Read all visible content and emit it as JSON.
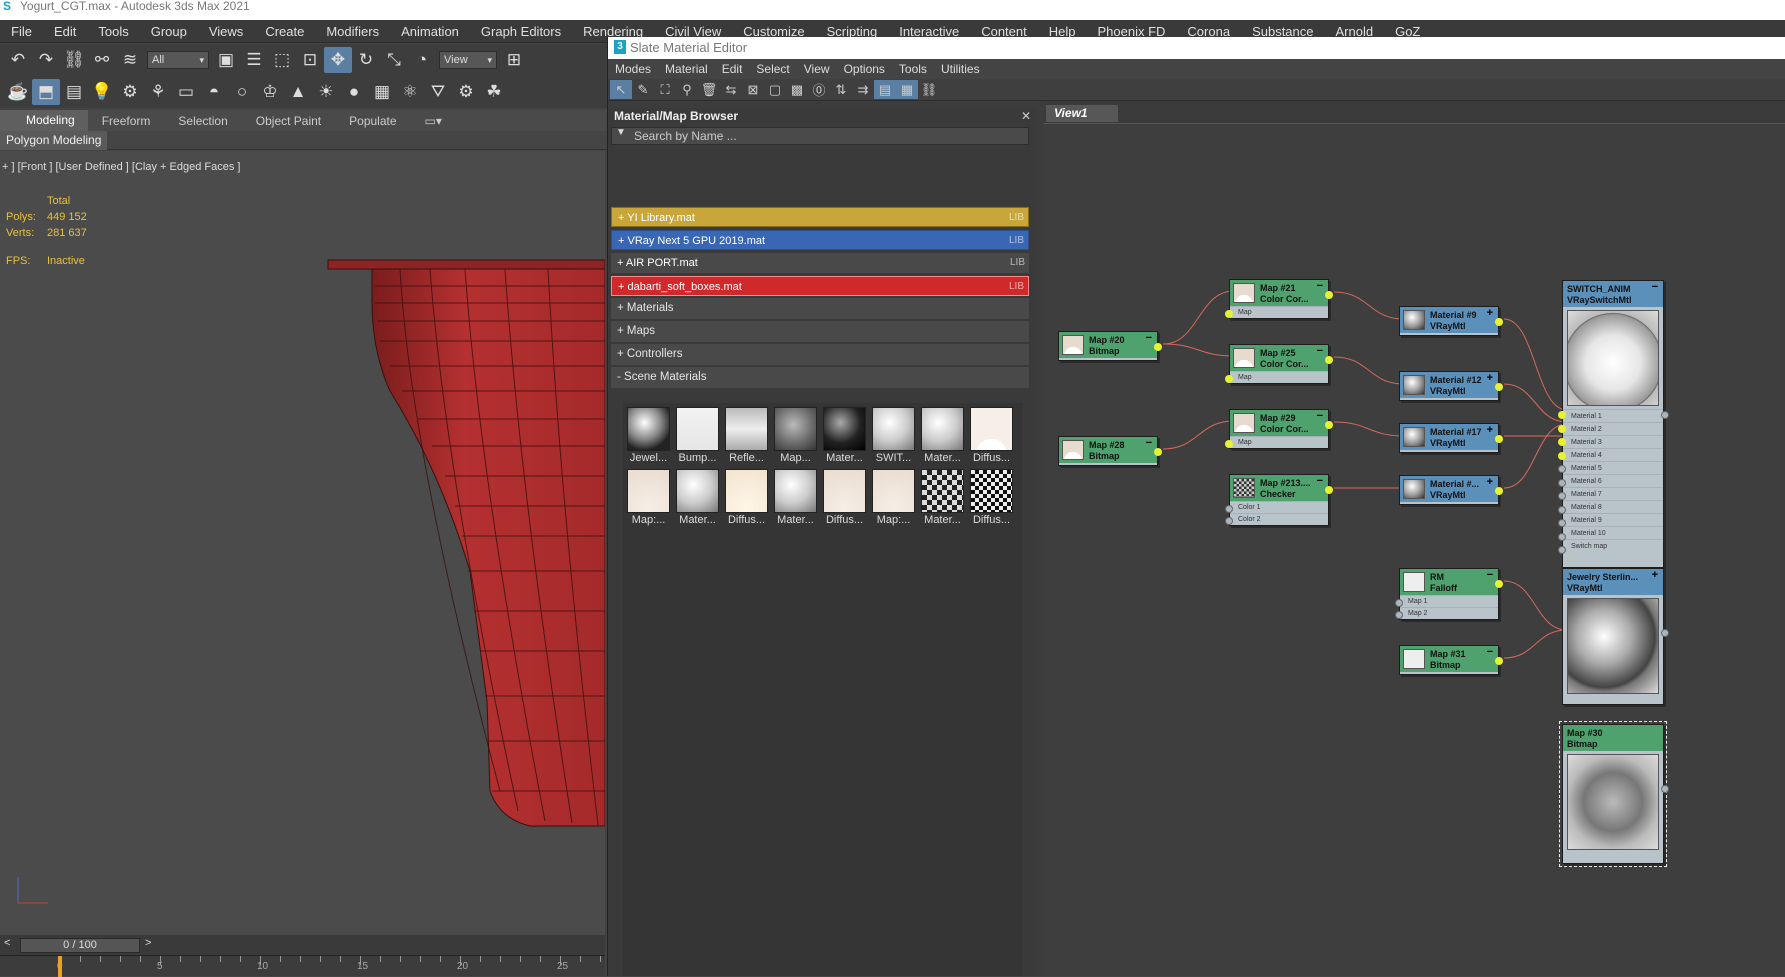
{
  "window": {
    "title": "Yogurt_CGT.max - Autodesk 3ds Max 2021"
  },
  "menubar": [
    "File",
    "Edit",
    "Tools",
    "Group",
    "Views",
    "Create",
    "Modifiers",
    "Animation",
    "Graph Editors",
    "Rendering",
    "Civil View",
    "Customize",
    "Scripting",
    "Interactive",
    "Content",
    "Help",
    "Phoenix FD",
    "Corona",
    "Substance",
    "Arnold",
    "GoZ"
  ],
  "toolbar": {
    "selection_filter": "All",
    "ref_coord": "View"
  },
  "ribbon": {
    "tabs": [
      "Modeling",
      "Freeform",
      "Selection",
      "Object Paint",
      "Populate"
    ],
    "active": "Modeling",
    "sub": "Polygon Modeling"
  },
  "viewport": {
    "label": "+ ] [Front ] [User Defined ] [Clay + Edged Faces ]",
    "total": "Total",
    "polys_label": "Polys:",
    "polys": "449 152",
    "verts_label": "Verts:",
    "verts": "281 637",
    "fps_label": "FPS:",
    "fps": "Inactive"
  },
  "timeline": {
    "frame": "0 / 100",
    "ticks": [
      "0",
      "5",
      "10",
      "15",
      "20",
      "25"
    ]
  },
  "slate": {
    "title": "Slate Material Editor",
    "menu": [
      "Modes",
      "Material",
      "Edit",
      "Select",
      "View",
      "Options",
      "Tools",
      "Utilities"
    ],
    "browser_title": "Material/Map Browser",
    "search_placeholder": "Search by Name ...",
    "libraries": [
      {
        "label": "+ YI Library.mat",
        "tag": "LIB",
        "color": "#c9a63a"
      },
      {
        "label": "+ VRay Next 5 GPU 2019.mat",
        "tag": "LIB",
        "color": "#3a67b3"
      },
      {
        "label": "+ AIR PORT.mat",
        "tag": "LIB",
        "color": "#494949"
      },
      {
        "label": "+ dabarti_soft_boxes.mat",
        "tag": "LIB",
        "color": "#d0282b"
      }
    ],
    "sections": [
      "+ Materials",
      "+ Maps",
      "+ Controllers",
      "- Scene Materials"
    ],
    "swatches": [
      "Jewel...",
      "Bump...",
      "Refle...",
      "Map...",
      "Mater...",
      "SWIT...",
      "Mater...",
      "Diffus...",
      "Map:...",
      "Mater...",
      "Diffus...",
      "Mater...",
      "Diffus...",
      "Map:...",
      "Mater...",
      "Diffus..."
    ],
    "view_tab": "View1"
  },
  "nodes": [
    {
      "id": "map20",
      "t1": "Map #20",
      "t2": "Bitmap",
      "color": "green",
      "slots": []
    },
    {
      "id": "map28",
      "t1": "Map #28",
      "t2": "Bitmap",
      "color": "green",
      "slots": []
    },
    {
      "id": "map21",
      "t1": "Map #21",
      "t2": "Color Cor...",
      "color": "green",
      "slots": [
        "Map"
      ]
    },
    {
      "id": "map25",
      "t1": "Map #25",
      "t2": "Color Cor...",
      "color": "green",
      "slots": [
        "Map"
      ]
    },
    {
      "id": "map29",
      "t1": "Map #29",
      "t2": "Color Cor...",
      "color": "green",
      "slots": [
        "Map"
      ]
    },
    {
      "id": "map213",
      "t1": "Map #213....",
      "t2": "Checker",
      "color": "green",
      "slots": [
        "Color 1",
        "Color 2"
      ]
    },
    {
      "id": "mat9",
      "t1": "Material #9",
      "t2": "VRayMtl",
      "color": "blue",
      "slots": []
    },
    {
      "id": "mat12",
      "t1": "Material #12",
      "t2": "VRayMtl",
      "color": "blue",
      "slots": []
    },
    {
      "id": "mat17",
      "t1": "Material #17",
      "t2": "VRayMtl",
      "color": "blue",
      "slots": []
    },
    {
      "id": "matx",
      "t1": "Material #...",
      "t2": "VRayMtl",
      "color": "blue",
      "slots": []
    },
    {
      "id": "rm",
      "t1": "RM",
      "t2": "Falloff",
      "color": "green",
      "slots": [
        "Map 1",
        "Map 2"
      ]
    },
    {
      "id": "map31",
      "t1": "Map #31",
      "t2": "Bitmap",
      "color": "green",
      "slots": []
    }
  ],
  "switch_node": {
    "t1": "SWITCH_ANIM",
    "t2": "VRaySwitchMtl",
    "slots": [
      "Material 1",
      "Material 2",
      "Material 3",
      "Material 4",
      "Material 5",
      "Material 6",
      "Material 7",
      "Material 8",
      "Material 9",
      "Material 10",
      "Switch map"
    ]
  },
  "jewelry_node": {
    "t1": "Jewelry Sterlin...",
    "t2": "VRayMtl"
  },
  "map30_node": {
    "t1": "Map #30",
    "t2": "Bitmap"
  }
}
